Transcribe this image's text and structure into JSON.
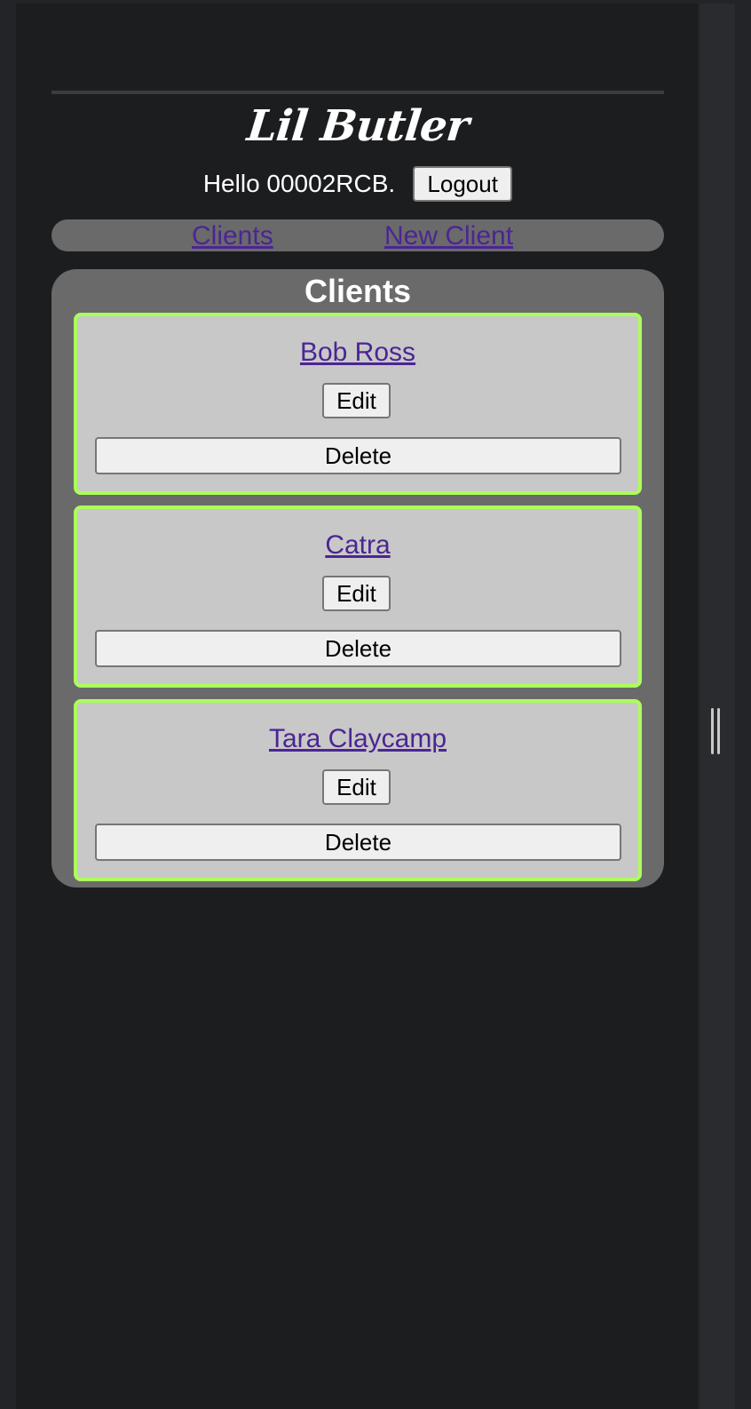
{
  "header": {
    "logo_text": "Lil Butler",
    "greeting": "Hello 00002RCB.",
    "logout_label": "Logout"
  },
  "nav": {
    "items": [
      {
        "label": "Clients"
      },
      {
        "label": "New Client"
      }
    ]
  },
  "clients": {
    "title": "Clients",
    "items": [
      {
        "name": "Bob Ross",
        "edit_label": "Edit",
        "delete_label": "Delete"
      },
      {
        "name": "Catra",
        "edit_label": "Edit",
        "delete_label": "Delete"
      },
      {
        "name": "Tara Claycamp",
        "edit_label": "Edit",
        "delete_label": "Delete"
      }
    ]
  },
  "colors": {
    "page_background": "#1c1d1f",
    "panel_background": "#6a6a6a",
    "card_background": "#c8c8c8",
    "card_border": "#aaff5a",
    "link": "#4b2594"
  },
  "icons": {
    "resize_handle": "resize-grip-icon"
  }
}
